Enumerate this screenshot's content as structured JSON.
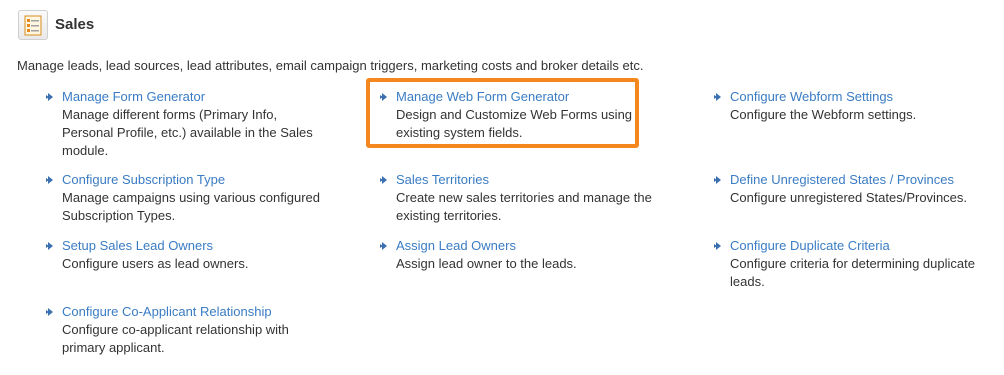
{
  "section": {
    "title": "Sales",
    "icon": "sales-document-icon",
    "description": "Manage leads, lead sources, lead attributes, email campaign triggers, marketing costs and broker details etc."
  },
  "colors": {
    "link": "#3a7cc4",
    "highlight": "#f5871f",
    "text": "#333333"
  },
  "items": [
    {
      "label": "Manage Form Generator",
      "description": "Manage different forms (Primary Info, Personal Profile, etc.) available in the Sales module."
    },
    {
      "label": "Manage Web Form Generator",
      "description": "Design and Customize Web Forms using existing system fields."
    },
    {
      "label": "Configure Webform Settings",
      "description": "Configure the Webform settings."
    },
    {
      "label": "Configure Subscription Type",
      "description": "Manage campaigns using various configured Subscription Types."
    },
    {
      "label": "Sales Territories",
      "description": "Create new sales territories and manage the existing territories."
    },
    {
      "label": "Define Unregistered States / Provinces",
      "description": "Configure unregistered States/Provinces."
    },
    {
      "label": "Setup Sales Lead Owners",
      "description": "Configure users as lead owners."
    },
    {
      "label": "Assign Lead Owners",
      "description": "Assign lead owner to the leads."
    },
    {
      "label": "Configure Duplicate Criteria",
      "description": "Configure criteria for determining duplicate leads."
    },
    {
      "label": "Configure Co-Applicant Relationship",
      "description": "Configure co-applicant relationship with primary applicant."
    }
  ]
}
